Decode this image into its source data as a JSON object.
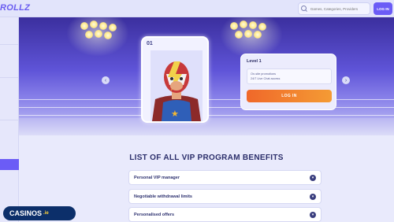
{
  "header": {
    "logo_text": "ROLLZ",
    "search_placeholder": "Games, Categories, Providers",
    "login_label": "LOG IN"
  },
  "hero": {
    "level_number": "01",
    "level_title": "Level 1",
    "features": [
      "On-site promotions",
      "24/7 Live Chat access"
    ],
    "login_label": "LOG IN"
  },
  "benefits": {
    "title": "LIST OF ALL VIP PROGRAM BENEFITS",
    "items": [
      {
        "label": "Personal VIP manager"
      },
      {
        "label": "Negotiable withdrawal limits"
      },
      {
        "label": "Personalised offers"
      }
    ]
  },
  "watermark": {
    "text": "CASINOS",
    "suffix": ".ie"
  },
  "colors": {
    "accent": "#6b5cf6",
    "login_orange": "#f0682a",
    "title": "#2c2f6b"
  },
  "icons": {
    "search": "search-icon",
    "prev": "chevron-left-icon",
    "next": "chevron-right-icon",
    "benefit_toggle": "chevron-down-icon",
    "star": "star-icon"
  }
}
